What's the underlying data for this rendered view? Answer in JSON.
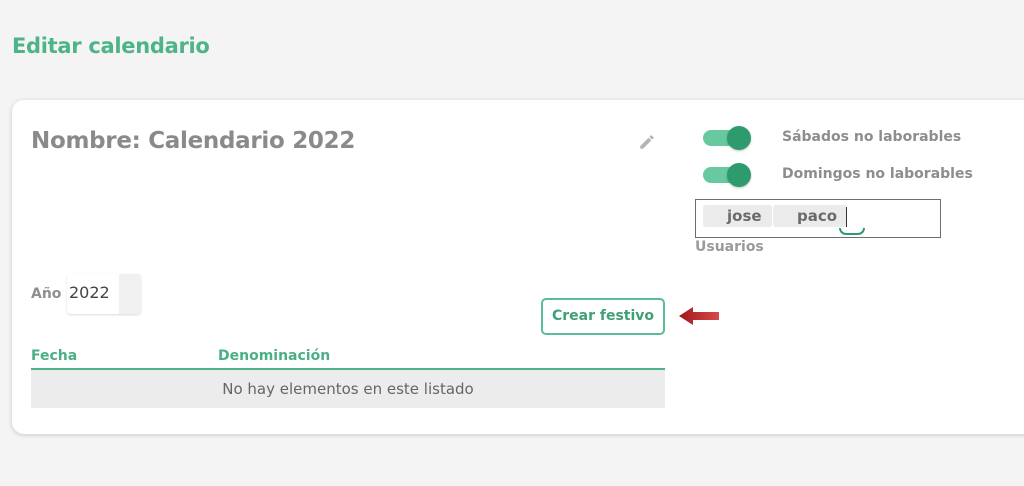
{
  "page": {
    "title": "Editar calendario"
  },
  "calendar": {
    "name_text": "Nombre: Calendario 2022"
  },
  "settings": {
    "saturdays_label": "Sábados no laborables",
    "saturdays_on": true,
    "sundays_label": "Domingos no laborables",
    "sundays_on": true
  },
  "users": {
    "chips": [
      "jose",
      "paco"
    ],
    "label": "Usuarios"
  },
  "year": {
    "label": "Año",
    "value": "2022"
  },
  "actions": {
    "create_holiday_label": "Crear festivo"
  },
  "table": {
    "columns": [
      "Fecha",
      "Denominación"
    ],
    "empty_message": "No hay elementos en este listado"
  },
  "colors": {
    "accent": "#4db389",
    "toggle_on": "#2e9b6f",
    "arrow": "#b01c1c"
  },
  "icons": {
    "edit": "pencil-icon",
    "annotation": "arrow-left-icon"
  }
}
